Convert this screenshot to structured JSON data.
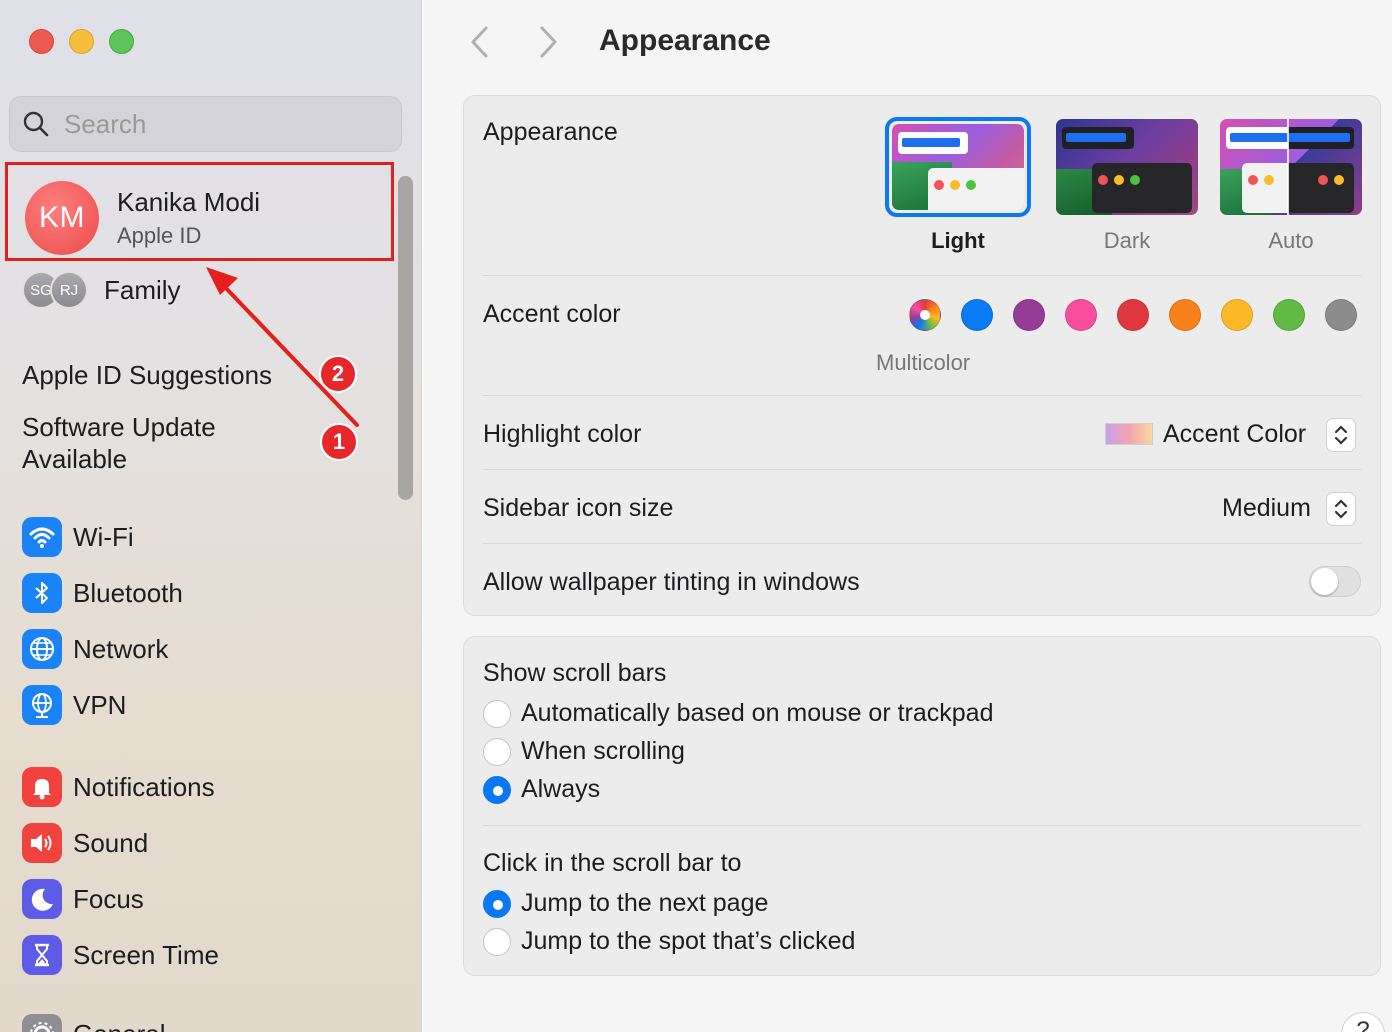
{
  "window": {
    "traffic_lights": [
      "close",
      "minimize",
      "zoom"
    ]
  },
  "sidebar": {
    "search": {
      "placeholder": "Search",
      "value": ""
    },
    "user": {
      "initials": "KM",
      "name": "Kanika Modi",
      "subtitle": "Apple ID"
    },
    "family": {
      "members": [
        "SG",
        "RJ"
      ],
      "label": "Family"
    },
    "suggestions": "Apple ID Suggestions",
    "software_update_line1": "Software Update",
    "software_update_line2": "Available",
    "badges": {
      "suggestions": "2",
      "update": "1"
    },
    "items": [
      {
        "label": "Wi-Fi",
        "icon": "wifi-icon",
        "color": "#1a84f6"
      },
      {
        "label": "Bluetooth",
        "icon": "bluetooth-icon",
        "color": "#1a84f6"
      },
      {
        "label": "Network",
        "icon": "globe-icon",
        "color": "#1a84f6"
      },
      {
        "label": "VPN",
        "icon": "vpn-globe-icon",
        "color": "#1a84f6"
      },
      {
        "label": "Notifications",
        "icon": "bell-icon",
        "color": "#f0433f"
      },
      {
        "label": "Sound",
        "icon": "speaker-icon",
        "color": "#f0433f"
      },
      {
        "label": "Focus",
        "icon": "moon-icon",
        "color": "#5e5ce6"
      },
      {
        "label": "Screen Time",
        "icon": "hourglass-icon",
        "color": "#5e5ce6"
      },
      {
        "label": "General",
        "icon": "gear-icon",
        "color": "#8e8e93"
      }
    ]
  },
  "main": {
    "title": "Appearance",
    "appearance": {
      "label": "Appearance",
      "options": [
        {
          "label": "Light",
          "selected": true
        },
        {
          "label": "Dark",
          "selected": false
        },
        {
          "label": "Auto",
          "selected": false
        }
      ]
    },
    "accent": {
      "label": "Accent color",
      "selected_label": "Multicolor",
      "colors": [
        "multicolor",
        "#0a7bf5",
        "#953d96",
        "#f74f9e",
        "#e0383e",
        "#f7821b",
        "#fcb827",
        "#62ba46",
        "#8c8c8c"
      ]
    },
    "highlight": {
      "label": "Highlight color",
      "value": "Accent Color"
    },
    "sidebar_icon_size": {
      "label": "Sidebar icon size",
      "value": "Medium"
    },
    "wallpaper_tinting": {
      "label": "Allow wallpaper tinting in windows",
      "enabled": false
    },
    "scroll_bars": {
      "label": "Show scroll bars",
      "options": [
        {
          "label": "Automatically based on mouse or trackpad",
          "selected": false
        },
        {
          "label": "When scrolling",
          "selected": false
        },
        {
          "label": "Always",
          "selected": true
        }
      ]
    },
    "click_scroll": {
      "label": "Click in the scroll bar to",
      "options": [
        {
          "label": "Jump to the next page",
          "selected": true
        },
        {
          "label": "Jump to the spot that’s clicked",
          "selected": false
        }
      ]
    },
    "help": "?"
  }
}
